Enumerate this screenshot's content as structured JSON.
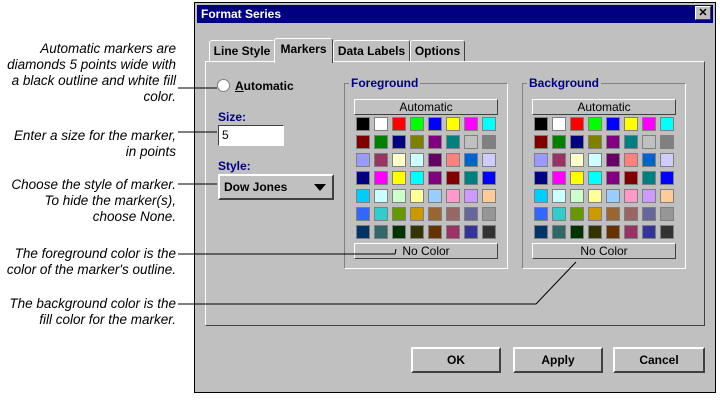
{
  "annotations": [
    {
      "lines": [
        "Automatic markers are",
        "diamonds 5 points wide with",
        "a black outline and white fill",
        "color."
      ]
    },
    {
      "lines": [
        "Enter a size for the marker,",
        "in points"
      ]
    },
    {
      "lines": [
        "Choose the style of marker.",
        "To hide the marker(s),",
        "choose None."
      ]
    },
    {
      "lines": [
        "The foreground color is the",
        "color of the marker's outline."
      ]
    },
    {
      "lines": [
        "The background color is the",
        "fill color for the marker."
      ]
    }
  ],
  "dialog": {
    "title": "Format Series",
    "close_label": "✕",
    "tabs": [
      {
        "label": "Line Style",
        "active": false
      },
      {
        "label": "Markers",
        "active": true
      },
      {
        "label": "Data Labels",
        "active": false
      },
      {
        "label": "Options",
        "active": false
      }
    ],
    "automatic_label_prefix": "A",
    "automatic_label_rest": "utomatic",
    "size_label": "Size:",
    "size_value": "5",
    "style_label": "Style:",
    "style_value": "Dow Jones",
    "foreground": {
      "title": "Foreground",
      "automatic_button": "Automatic",
      "nocolor_button": "No Color"
    },
    "background": {
      "title": "Background",
      "automatic_button": "Automatic",
      "nocolor_button": "No Color"
    },
    "buttons": {
      "ok": "OK",
      "apply": "Apply",
      "cancel": "Cancel"
    }
  },
  "palette": [
    [
      "#000000",
      "#ffffff",
      "#ff0000",
      "#00ff00",
      "#0000ff",
      "#ffff00",
      "#ff00ff",
      "#00ffff"
    ],
    [
      "#800000",
      "#008000",
      "#000080",
      "#808000",
      "#800080",
      "#008080",
      "#c0c0c0",
      "#808080"
    ],
    [
      "#9999ff",
      "#993366",
      "#ffffcc",
      "#ccffff",
      "#660066",
      "#ff8080",
      "#0066cc",
      "#ccccff"
    ],
    [
      "#000080",
      "#ff00ff",
      "#ffff00",
      "#00ffff",
      "#800080",
      "#800000",
      "#008080",
      "#0000ff"
    ],
    [
      "#00ccff",
      "#ccffff",
      "#ccffcc",
      "#ffff99",
      "#99ccff",
      "#ff99cc",
      "#cc99ff",
      "#ffcc99"
    ],
    [
      "#3366ff",
      "#33cccc",
      "#669900",
      "#cc9900",
      "#996633",
      "#996666",
      "#666699",
      "#969696"
    ],
    [
      "#003366",
      "#336666",
      "#003300",
      "#333300",
      "#663300",
      "#993366",
      "#333399",
      "#333333"
    ]
  ]
}
